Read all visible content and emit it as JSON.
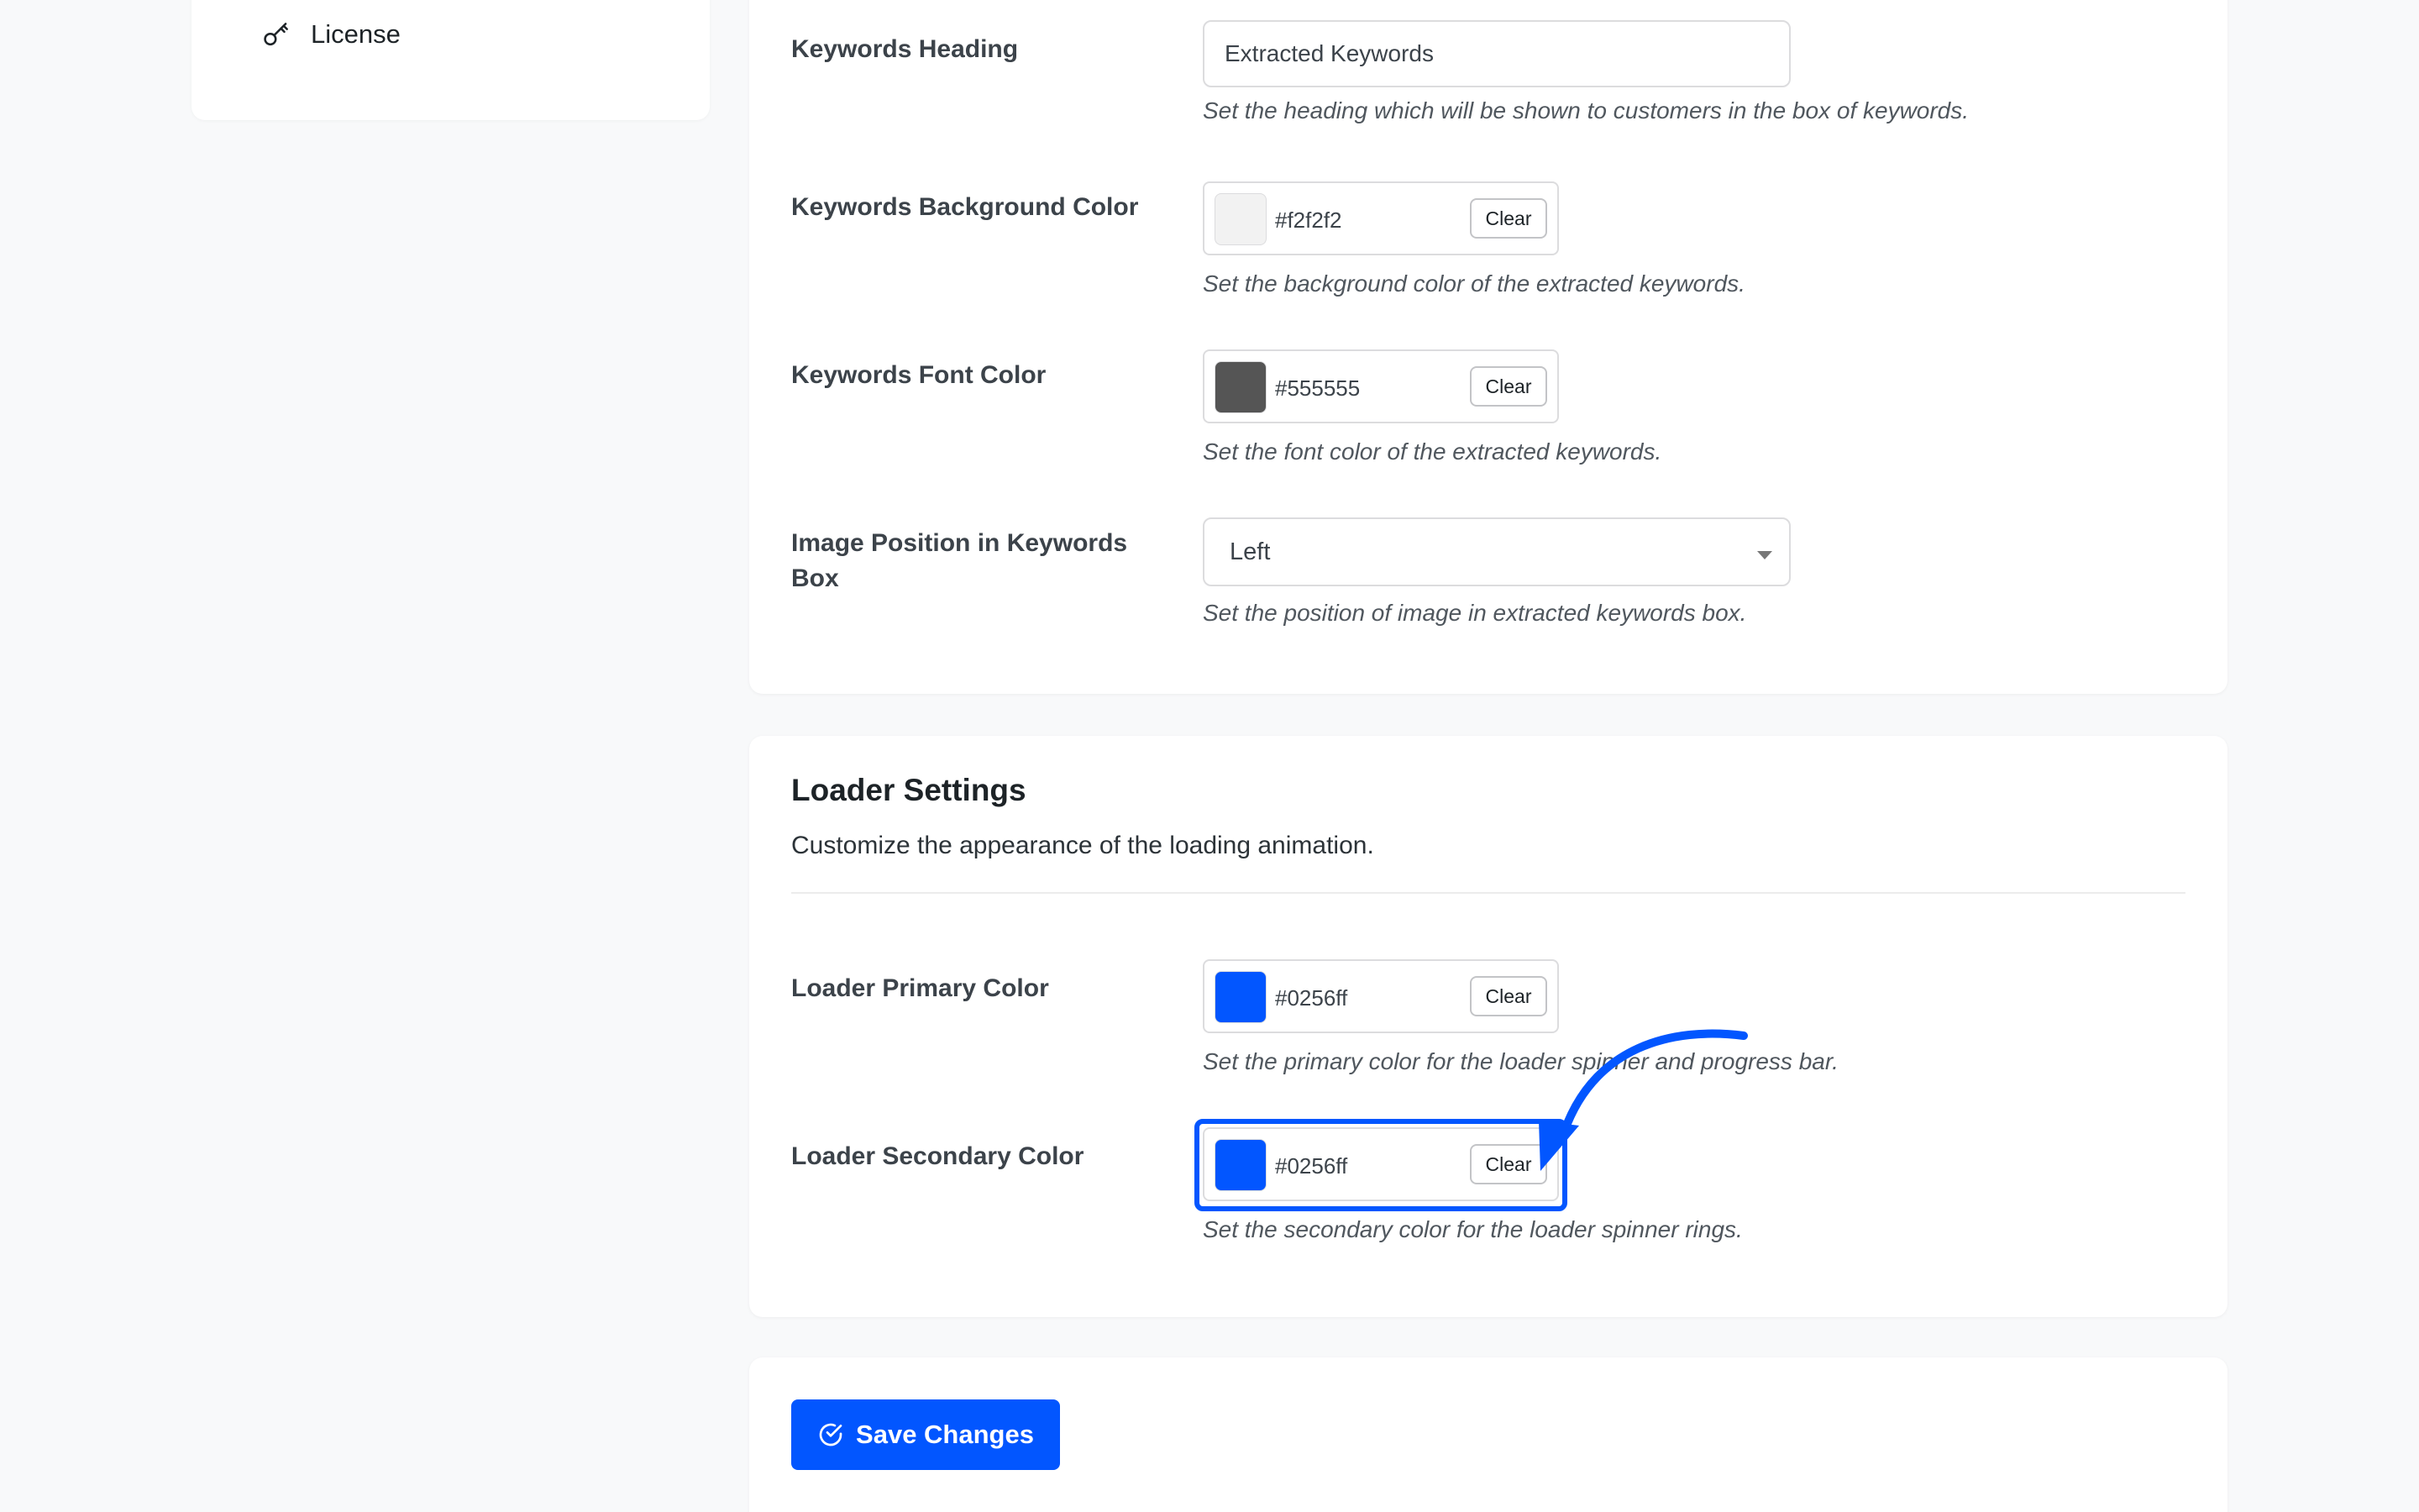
{
  "sidebar": {
    "items": [
      {
        "label": "License",
        "icon": "key-icon"
      }
    ]
  },
  "keywords_section": {
    "heading_field": {
      "label": "Keywords Heading",
      "value": "Extracted Keywords",
      "description": "Set the heading which will be shown to customers in the box of keywords."
    },
    "background_color": {
      "label": "Keywords Background Color",
      "value": "#f2f2f2",
      "swatch_color": "#f2f2f2",
      "clear_label": "Clear",
      "description": "Set the background color of the extracted keywords."
    },
    "font_color": {
      "label": "Keywords Font Color",
      "value": "#555555",
      "swatch_color": "#555555",
      "clear_label": "Clear",
      "description": "Set the font color of the extracted keywords."
    },
    "image_position": {
      "label": "Image Position in Keywords Box",
      "selected": "Left",
      "description": "Set the position of image in extracted keywords box."
    }
  },
  "loader_section": {
    "title": "Loader Settings",
    "description": "Customize the appearance of the loading animation.",
    "primary_color": {
      "label": "Loader Primary Color",
      "value": "#0256ff",
      "swatch_color": "#0256ff",
      "clear_label": "Clear",
      "description": "Set the primary color for the loader spinner and progress bar."
    },
    "secondary_color": {
      "label": "Loader Secondary Color",
      "value": "#0256ff",
      "swatch_color": "#0256ff",
      "clear_label": "Clear",
      "description": "Set the secondary color for the loader spinner rings."
    }
  },
  "actions": {
    "save_label": "Save Changes"
  },
  "colors": {
    "accent": "#0256ff",
    "page_background": "#f8f9fa",
    "card_background": "#ffffff"
  }
}
